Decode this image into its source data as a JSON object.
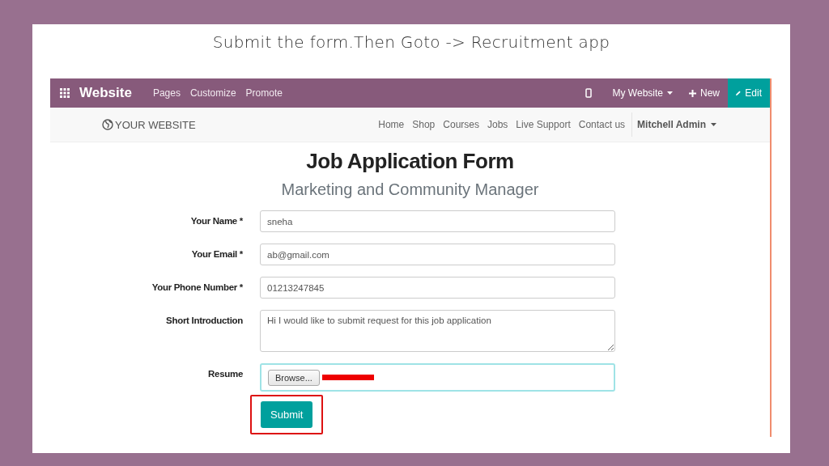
{
  "slide": {
    "caption": "Submit the form.Then Goto -> Recruitment app"
  },
  "admin_bar": {
    "app_name": "Website",
    "menu": [
      "Pages",
      "Customize",
      "Promote"
    ],
    "site_switcher": "My Website",
    "new_button": "New",
    "edit_button": "Edit"
  },
  "site_nav": {
    "logo": "YOUR WEBSITE",
    "links": [
      "Home",
      "Shop",
      "Courses",
      "Jobs",
      "Live Support",
      "Contact us"
    ],
    "user": "Mitchell Admin"
  },
  "form": {
    "title": "Job Application Form",
    "subtitle": "Marketing and Community Manager",
    "fields": [
      {
        "kind": "text",
        "label": "Your Name *",
        "value": "sneha",
        "focused": false
      },
      {
        "kind": "text",
        "label": "Your Email *",
        "value": "ab@gmail.com",
        "focused": false
      },
      {
        "kind": "text",
        "label": "Your Phone Number *",
        "value": "01213247845",
        "focused": false
      },
      {
        "kind": "textarea",
        "label": "Short Introduction",
        "value": "Hi I would like to submit request for this job application",
        "focused": false
      },
      {
        "kind": "file",
        "label": "Resume",
        "browse": "Browse...",
        "focused": true
      }
    ],
    "submit": "Submit"
  }
}
